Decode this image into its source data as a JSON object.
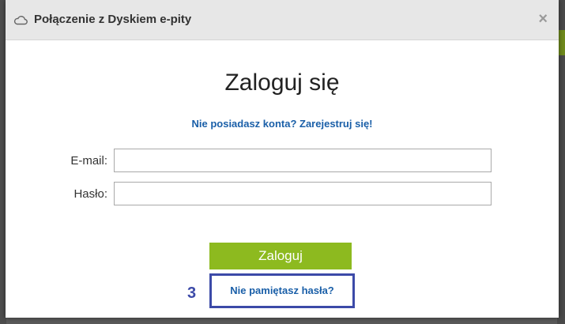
{
  "dialog": {
    "title": "Połączenie z Dyskiem e-pity",
    "close_symbol": "×",
    "heading": "Zaloguj się",
    "register_link": "Nie posiadasz konta? Zarejestruj się!",
    "email_label": "E-mail:",
    "email_value": "",
    "password_label": "Hasło:",
    "password_value": "",
    "login_button": "Zaloguj",
    "forgot_link": "Nie pamiętasz hasła?",
    "step_number": "3"
  },
  "colors": {
    "accent_green": "#8dba1f",
    "link_blue": "#1a5fa8",
    "highlight_border": "#3c4aa8"
  },
  "icons": {
    "header": "cloud-icon",
    "close": "close-icon"
  }
}
